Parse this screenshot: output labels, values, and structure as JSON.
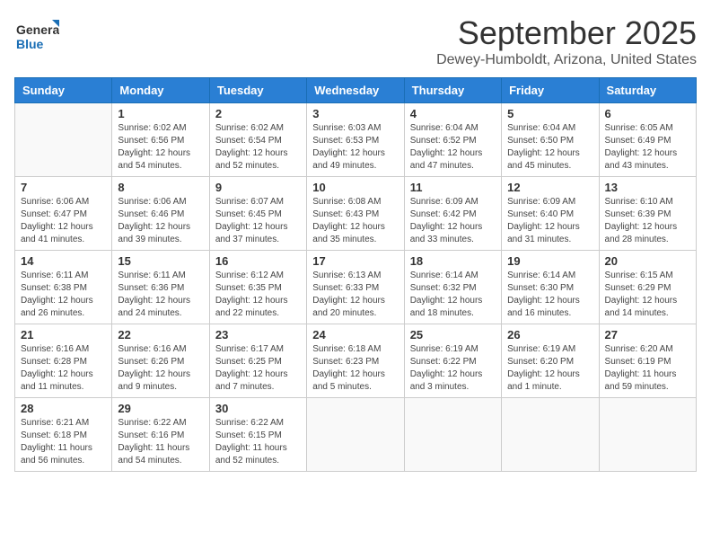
{
  "app": {
    "logo_general": "General",
    "logo_blue": "Blue",
    "month": "September 2025",
    "location": "Dewey-Humboldt, Arizona, United States"
  },
  "calendar": {
    "headers": [
      "Sunday",
      "Monday",
      "Tuesday",
      "Wednesday",
      "Thursday",
      "Friday",
      "Saturday"
    ],
    "weeks": [
      [
        {
          "day": "",
          "sunrise": "",
          "sunset": "",
          "daylight": ""
        },
        {
          "day": "1",
          "sunrise": "Sunrise: 6:02 AM",
          "sunset": "Sunset: 6:56 PM",
          "daylight": "Daylight: 12 hours and 54 minutes."
        },
        {
          "day": "2",
          "sunrise": "Sunrise: 6:02 AM",
          "sunset": "Sunset: 6:54 PM",
          "daylight": "Daylight: 12 hours and 52 minutes."
        },
        {
          "day": "3",
          "sunrise": "Sunrise: 6:03 AM",
          "sunset": "Sunset: 6:53 PM",
          "daylight": "Daylight: 12 hours and 49 minutes."
        },
        {
          "day": "4",
          "sunrise": "Sunrise: 6:04 AM",
          "sunset": "Sunset: 6:52 PM",
          "daylight": "Daylight: 12 hours and 47 minutes."
        },
        {
          "day": "5",
          "sunrise": "Sunrise: 6:04 AM",
          "sunset": "Sunset: 6:50 PM",
          "daylight": "Daylight: 12 hours and 45 minutes."
        },
        {
          "day": "6",
          "sunrise": "Sunrise: 6:05 AM",
          "sunset": "Sunset: 6:49 PM",
          "daylight": "Daylight: 12 hours and 43 minutes."
        }
      ],
      [
        {
          "day": "7",
          "sunrise": "Sunrise: 6:06 AM",
          "sunset": "Sunset: 6:47 PM",
          "daylight": "Daylight: 12 hours and 41 minutes."
        },
        {
          "day": "8",
          "sunrise": "Sunrise: 6:06 AM",
          "sunset": "Sunset: 6:46 PM",
          "daylight": "Daylight: 12 hours and 39 minutes."
        },
        {
          "day": "9",
          "sunrise": "Sunrise: 6:07 AM",
          "sunset": "Sunset: 6:45 PM",
          "daylight": "Daylight: 12 hours and 37 minutes."
        },
        {
          "day": "10",
          "sunrise": "Sunrise: 6:08 AM",
          "sunset": "Sunset: 6:43 PM",
          "daylight": "Daylight: 12 hours and 35 minutes."
        },
        {
          "day": "11",
          "sunrise": "Sunrise: 6:09 AM",
          "sunset": "Sunset: 6:42 PM",
          "daylight": "Daylight: 12 hours and 33 minutes."
        },
        {
          "day": "12",
          "sunrise": "Sunrise: 6:09 AM",
          "sunset": "Sunset: 6:40 PM",
          "daylight": "Daylight: 12 hours and 31 minutes."
        },
        {
          "day": "13",
          "sunrise": "Sunrise: 6:10 AM",
          "sunset": "Sunset: 6:39 PM",
          "daylight": "Daylight: 12 hours and 28 minutes."
        }
      ],
      [
        {
          "day": "14",
          "sunrise": "Sunrise: 6:11 AM",
          "sunset": "Sunset: 6:38 PM",
          "daylight": "Daylight: 12 hours and 26 minutes."
        },
        {
          "day": "15",
          "sunrise": "Sunrise: 6:11 AM",
          "sunset": "Sunset: 6:36 PM",
          "daylight": "Daylight: 12 hours and 24 minutes."
        },
        {
          "day": "16",
          "sunrise": "Sunrise: 6:12 AM",
          "sunset": "Sunset: 6:35 PM",
          "daylight": "Daylight: 12 hours and 22 minutes."
        },
        {
          "day": "17",
          "sunrise": "Sunrise: 6:13 AM",
          "sunset": "Sunset: 6:33 PM",
          "daylight": "Daylight: 12 hours and 20 minutes."
        },
        {
          "day": "18",
          "sunrise": "Sunrise: 6:14 AM",
          "sunset": "Sunset: 6:32 PM",
          "daylight": "Daylight: 12 hours and 18 minutes."
        },
        {
          "day": "19",
          "sunrise": "Sunrise: 6:14 AM",
          "sunset": "Sunset: 6:30 PM",
          "daylight": "Daylight: 12 hours and 16 minutes."
        },
        {
          "day": "20",
          "sunrise": "Sunrise: 6:15 AM",
          "sunset": "Sunset: 6:29 PM",
          "daylight": "Daylight: 12 hours and 14 minutes."
        }
      ],
      [
        {
          "day": "21",
          "sunrise": "Sunrise: 6:16 AM",
          "sunset": "Sunset: 6:28 PM",
          "daylight": "Daylight: 12 hours and 11 minutes."
        },
        {
          "day": "22",
          "sunrise": "Sunrise: 6:16 AM",
          "sunset": "Sunset: 6:26 PM",
          "daylight": "Daylight: 12 hours and 9 minutes."
        },
        {
          "day": "23",
          "sunrise": "Sunrise: 6:17 AM",
          "sunset": "Sunset: 6:25 PM",
          "daylight": "Daylight: 12 hours and 7 minutes."
        },
        {
          "day": "24",
          "sunrise": "Sunrise: 6:18 AM",
          "sunset": "Sunset: 6:23 PM",
          "daylight": "Daylight: 12 hours and 5 minutes."
        },
        {
          "day": "25",
          "sunrise": "Sunrise: 6:19 AM",
          "sunset": "Sunset: 6:22 PM",
          "daylight": "Daylight: 12 hours and 3 minutes."
        },
        {
          "day": "26",
          "sunrise": "Sunrise: 6:19 AM",
          "sunset": "Sunset: 6:20 PM",
          "daylight": "Daylight: 12 hours and 1 minute."
        },
        {
          "day": "27",
          "sunrise": "Sunrise: 6:20 AM",
          "sunset": "Sunset: 6:19 PM",
          "daylight": "Daylight: 11 hours and 59 minutes."
        }
      ],
      [
        {
          "day": "28",
          "sunrise": "Sunrise: 6:21 AM",
          "sunset": "Sunset: 6:18 PM",
          "daylight": "Daylight: 11 hours and 56 minutes."
        },
        {
          "day": "29",
          "sunrise": "Sunrise: 6:22 AM",
          "sunset": "Sunset: 6:16 PM",
          "daylight": "Daylight: 11 hours and 54 minutes."
        },
        {
          "day": "30",
          "sunrise": "Sunrise: 6:22 AM",
          "sunset": "Sunset: 6:15 PM",
          "daylight": "Daylight: 11 hours and 52 minutes."
        },
        {
          "day": "",
          "sunrise": "",
          "sunset": "",
          "daylight": ""
        },
        {
          "day": "",
          "sunrise": "",
          "sunset": "",
          "daylight": ""
        },
        {
          "day": "",
          "sunrise": "",
          "sunset": "",
          "daylight": ""
        },
        {
          "day": "",
          "sunrise": "",
          "sunset": "",
          "daylight": ""
        }
      ]
    ]
  }
}
